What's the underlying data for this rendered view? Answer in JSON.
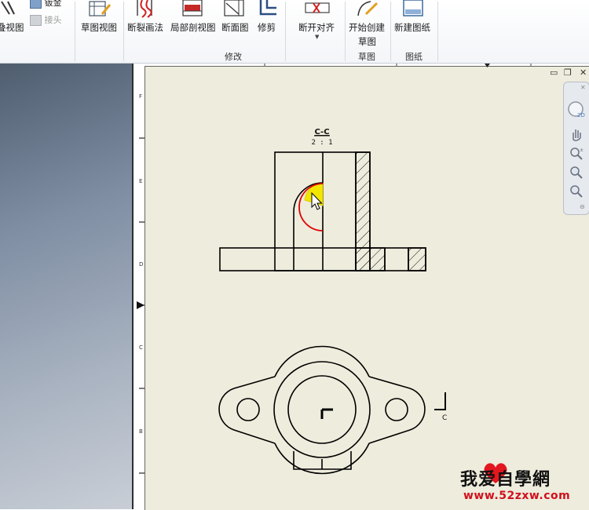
{
  "ribbon": {
    "buttons": {
      "overlay_view": "叠视图",
      "sheet_metal": "钣金",
      "joint": "接头",
      "sketch_view": "草图视图",
      "break_out": "断裂画法",
      "break_section": "局部剖视图",
      "section_view": "断面图",
      "crop": "修剪",
      "break_align": "断开对齐",
      "start_sketch_line1": "开始创建",
      "start_sketch_line2": "草图",
      "new_sheet": "新建图纸"
    },
    "groups": {
      "modify": "修改",
      "sketch": "草图",
      "sheet": "图纸"
    }
  },
  "drawing": {
    "view_label_name": "C-C",
    "view_label_scale": "2 : 1",
    "section_marker": "C",
    "border_zones": [
      "F",
      "E",
      "D",
      "C",
      "B"
    ]
  },
  "watermark": {
    "line1": "我爱自學網",
    "line2": "www.52zxw.com"
  },
  "colors": {
    "highlight": "#f2e600",
    "selection_arc": "#e00000",
    "sheet": "#eeecdc"
  }
}
